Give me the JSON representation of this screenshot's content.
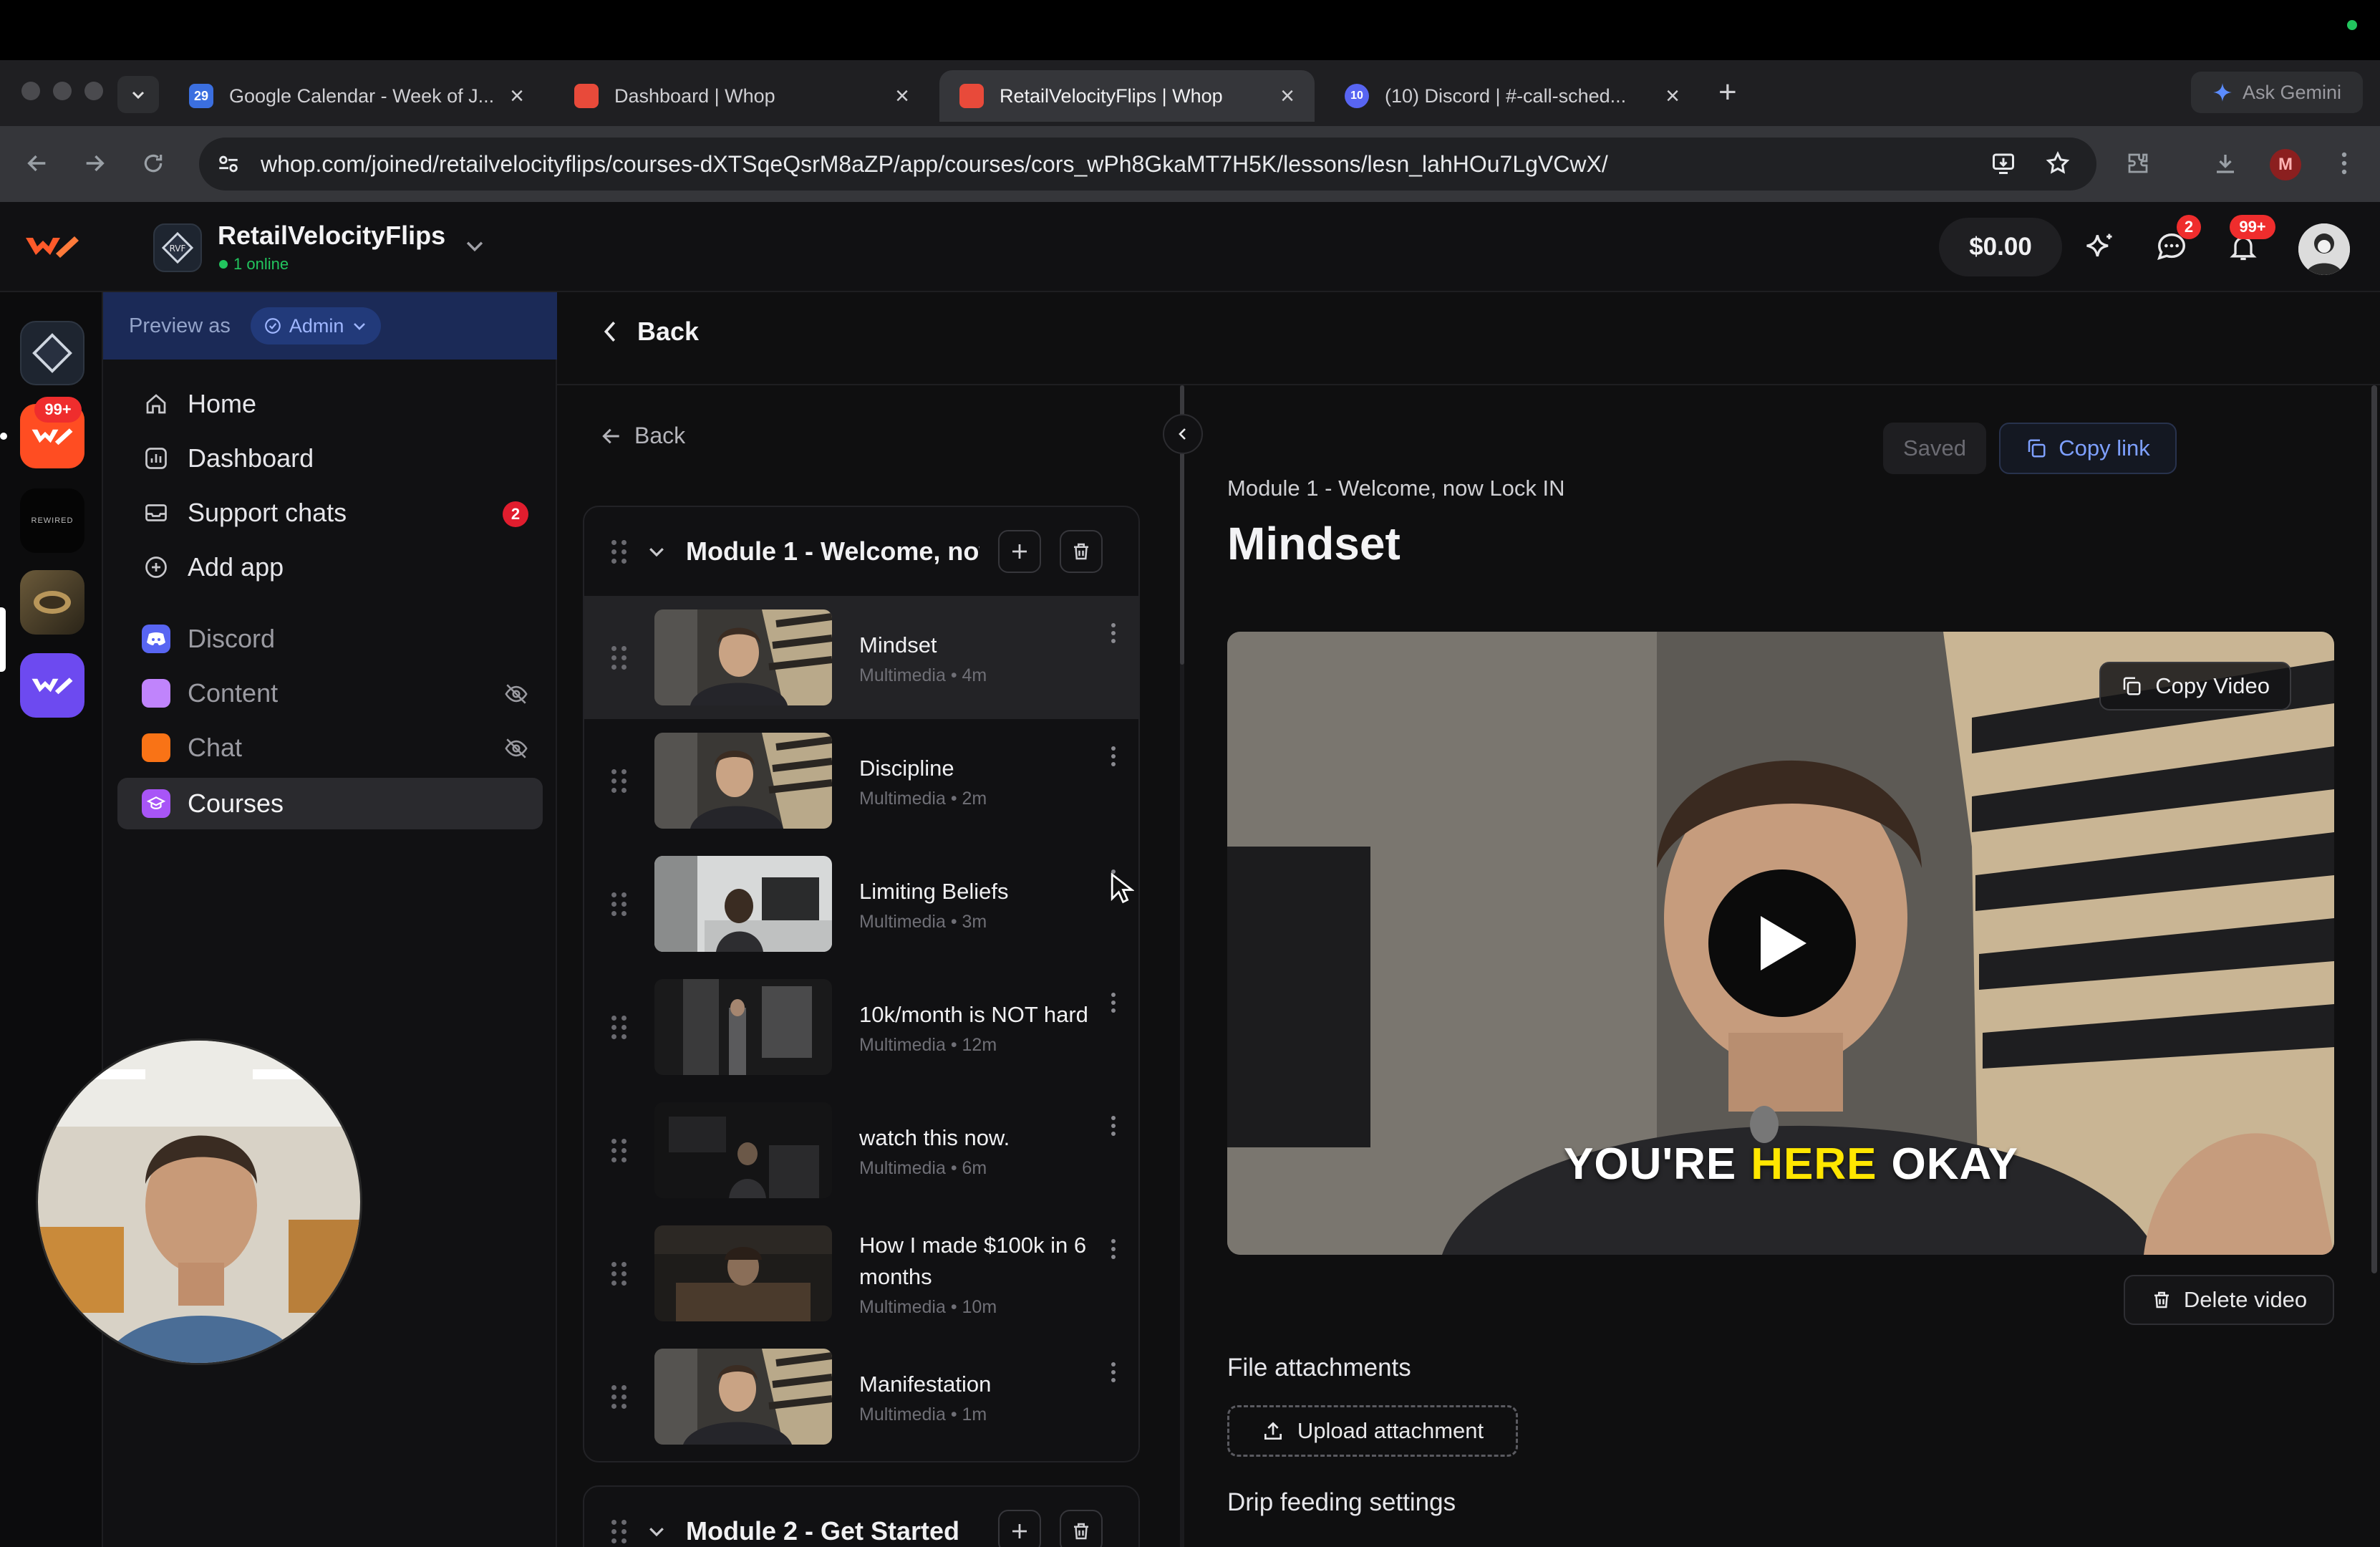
{
  "browser": {
    "tabs": [
      {
        "title": "Google Calendar - Week of J...",
        "favicon_color": "#3b6fe0",
        "active": false
      },
      {
        "title": "Dashboard | Whop",
        "favicon_color": "#e84a3a",
        "active": false
      },
      {
        "title": "RetailVelocityFlips | Whop",
        "favicon_color": "#e84a3a",
        "active": true
      },
      {
        "title": "(10) Discord | #​-call-sched...",
        "favicon_color": "#5865f2",
        "active": false
      }
    ],
    "calendar_fav_text": "29",
    "discord_fav_text": "10",
    "tab_close": "×",
    "new_tab": "+",
    "gemini_label": "Ask Gemini",
    "url": "whop.com/joined/retailvelocityflips/courses-dXTSqeQsrM8aZP/app/courses/cors_wPh8GkaMT7H5K/lessons/lesn_lahHOu7LgVCwX/",
    "profile_initial": "M"
  },
  "header": {
    "business_name": "RetailVelocityFlips",
    "business_initials": "RVF",
    "online_text": "1 online",
    "balance": "$0.00",
    "chat_badge": "2",
    "notif_badge": "99+"
  },
  "rail": {
    "app_badge": "99+",
    "rewired_label": "REWIRED"
  },
  "sidebar": {
    "preview_label": "Preview as",
    "role": "Admin",
    "nav": [
      {
        "label": "Home",
        "icon": "home-icon"
      },
      {
        "label": "Dashboard",
        "icon": "dashboard-icon"
      },
      {
        "label": "Support chats",
        "icon": "inbox-icon",
        "badge": "2"
      },
      {
        "label": "Add app",
        "icon": "plus-circle-icon"
      }
    ],
    "apps": [
      {
        "label": "Discord",
        "color": "#5865f2"
      },
      {
        "label": "Content",
        "color": "#c084fc"
      },
      {
        "label": "Chat",
        "color": "#f97316"
      },
      {
        "label": "Courses",
        "color": "#a855f7"
      }
    ]
  },
  "main": {
    "back_label": "Back",
    "inner_back_label": "Back",
    "modules": [
      {
        "title": "Module 1 - Welcome, now Lock IN",
        "lessons": [
          {
            "title": "Mindset",
            "meta": "Multimedia • 4m"
          },
          {
            "title": "Discipline",
            "meta": "Multimedia • 2m"
          },
          {
            "title": "Limiting Beliefs",
            "meta": "Multimedia • 3m"
          },
          {
            "title": "10k/month is NOT hard",
            "meta": "Multimedia • 12m"
          },
          {
            "title": "watch this now.",
            "meta": "Multimedia • 6m"
          },
          {
            "title": "How I made $100k in 6 months",
            "meta": "Multimedia • 10m"
          },
          {
            "title": "Manifestation",
            "meta": "Multimedia • 1m"
          }
        ]
      },
      {
        "title": "Module 2 - Get Started"
      }
    ],
    "editor": {
      "saved_label": "Saved",
      "copy_link_label": "Copy link",
      "module_name": "Module 1 - Welcome, now Lock IN",
      "lesson_title": "Mindset",
      "copy_video_label": "Copy Video",
      "caption_1": "YOU'RE",
      "caption_2": "HERE",
      "caption_3": "OKAY",
      "delete_video_label": "Delete video",
      "files_label": "File attachments",
      "upload_label": "Upload attachment",
      "drip_label": "Drip feeding settings"
    }
  },
  "colors": {
    "accent_blue": "#7ea0ff",
    "online_green": "#22c55e",
    "badge_red": "#ef2d2d",
    "caption_yellow": "#ffe600"
  }
}
